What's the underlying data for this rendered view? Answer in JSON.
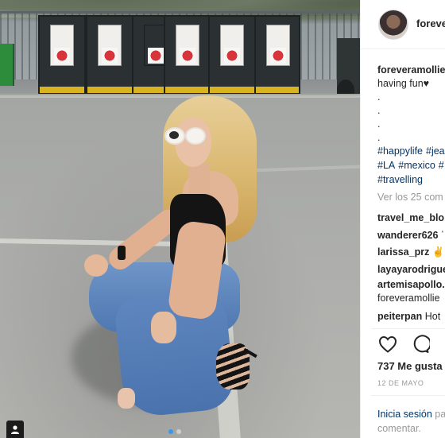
{
  "post": {
    "username": "foreveramollie",
    "header_username": "foreve",
    "caption_user": "foreveramollie",
    "caption_text": "having fun♥",
    "caption_dots": [
      ".",
      ".",
      ".",
      "."
    ],
    "hashtags_line1": [
      "#happylife",
      "#jea"
    ],
    "hashtags_line2": [
      "#LA",
      "#mexico",
      "#"
    ],
    "hashtags_line3": [
      "#travelling"
    ],
    "view_comments": "Ver los 25 com",
    "comments": [
      {
        "user": "travel_me_blo",
        "text": ""
      },
      {
        "user": "wanderer626",
        "text": " ῾"
      },
      {
        "user": "larissa_prz",
        "text": " ✌✌"
      },
      {
        "user": "layayarodrigue",
        "text": ""
      },
      {
        "user": "artemisapollo.",
        "text": ""
      },
      {
        "user": "",
        "text": "foreveramollie"
      },
      {
        "user": "peiterpan",
        "text": " Hot"
      }
    ],
    "likes": "737 Me gusta",
    "date": "12 DE MAYO",
    "login_link": "Inicia sesión",
    "login_rest": " pa",
    "login_line2": "comentar."
  },
  "carousel": {
    "count": 2,
    "active_index": 0
  },
  "icons": [
    "heart-icon",
    "comment-icon",
    "user-icon"
  ],
  "colors": {
    "link": "#003569",
    "muted": "#999999",
    "active_dot": "#3897f0",
    "text": "#262626"
  }
}
